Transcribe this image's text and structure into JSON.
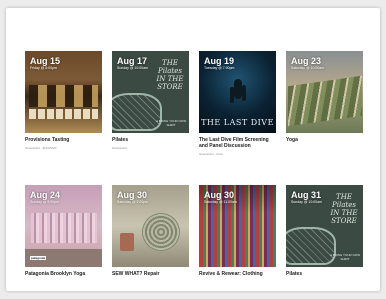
{
  "events": [
    {
      "date": "Aug 15",
      "sub": "Friday @ 6:00pm",
      "title": "Provisions Tasting",
      "meta": "Greenpoint · $10 RSVP",
      "thumb": "t-prov"
    },
    {
      "date": "Aug 17",
      "sub": "Sunday @ 10:00am",
      "title": "Pilates",
      "meta": "Greenpoint",
      "thumb": "t-pilates",
      "overlay": "THE Pilates IN THE STORE",
      "tagline": "A BRING YOUR OWN SHIRT"
    },
    {
      "date": "Aug 19",
      "sub": "Tuesday @ 7:00pm",
      "title": "The Last Dive Film Screening and Panel Discussion",
      "meta": "Greenpoint · Free",
      "thumb": "t-dive",
      "overlay": "THE LAST DIVE"
    },
    {
      "date": "Aug 23",
      "sub": "Saturday @ 10:00am",
      "title": "Yoga",
      "meta": "",
      "thumb": "t-yoga"
    },
    {
      "date": "Aug 24",
      "sub": "Sunday @ 5:00pm",
      "title": "Patagonia Brooklyn Yoga",
      "meta": "",
      "thumb": "t-pata",
      "logo": "patagonia"
    },
    {
      "date": "Aug 30",
      "sub": "Saturday @ 2:00pm",
      "title": "SEW WHAT? Repair",
      "meta": "",
      "thumb": "t-sew"
    },
    {
      "date": "Aug 30",
      "sub": "Saturday @ 11:00am",
      "title": "Revive & Rewear: Clothing",
      "meta": "",
      "thumb": "t-revive"
    },
    {
      "date": "Aug 31",
      "sub": "Sunday @ 10:00am",
      "title": "Pilates",
      "meta": "",
      "thumb": "t-pilates",
      "overlay": "THE Pilates IN THE STORE",
      "tagline": "A BRING YOUR OWN SHIRT"
    }
  ]
}
